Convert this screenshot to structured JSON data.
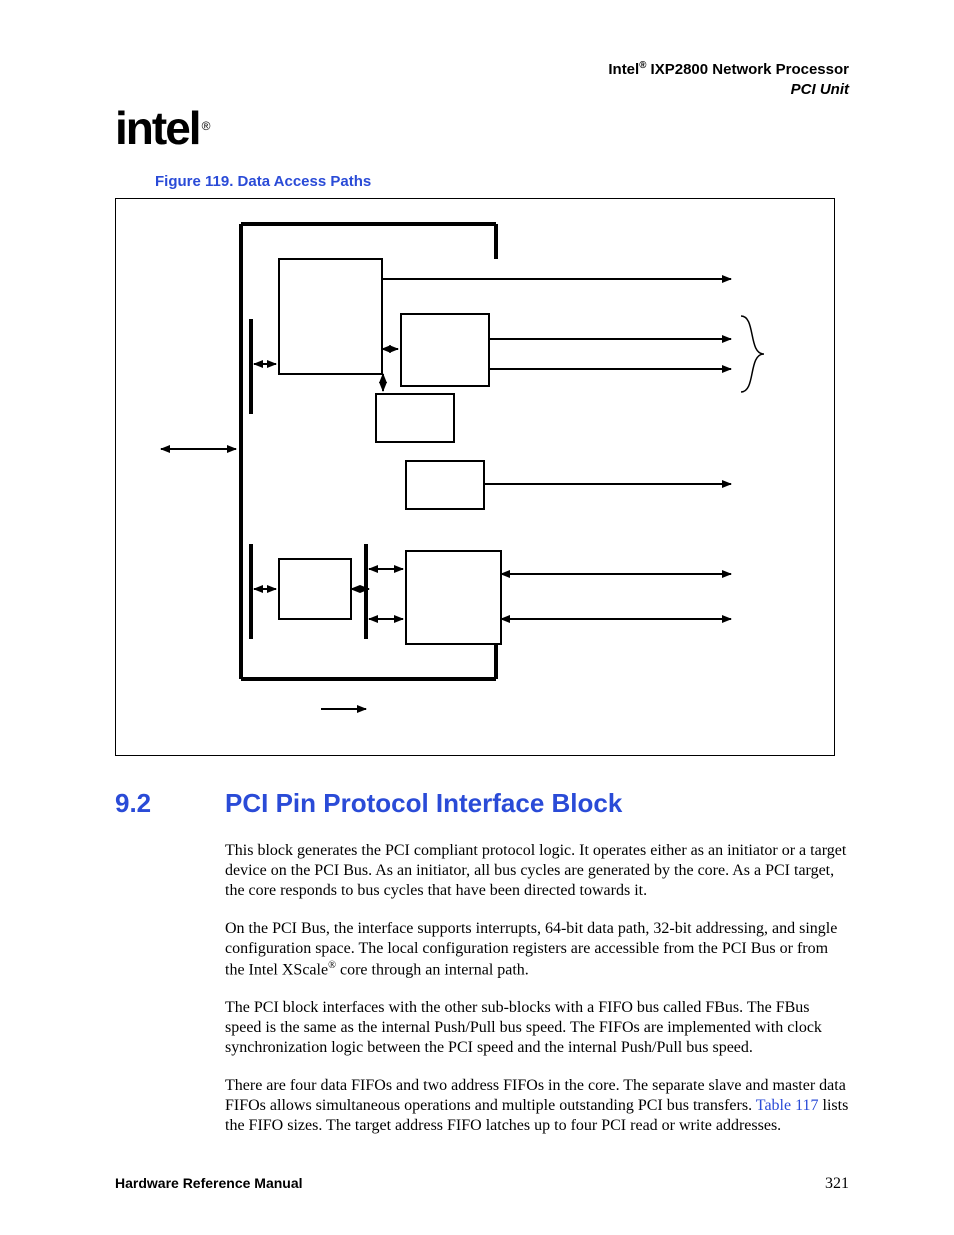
{
  "header": {
    "product_prefix": "Intel",
    "product": " IXP2800 Network Processor",
    "unit": "PCI Unit"
  },
  "logo": {
    "text": "intel",
    "reg": "®"
  },
  "figure": {
    "caption": "Figure 119. Data Access Paths"
  },
  "section": {
    "number": "9.2",
    "title": "PCI Pin Protocol Interface Block"
  },
  "paragraphs": {
    "p1": "This block generates the PCI compliant protocol logic. It operates either as an initiator or a target device on the PCI Bus. As an initiator, all bus cycles are generated by the core. As a PCI target, the core responds to bus cycles that have been directed towards it.",
    "p2a": "On the PCI Bus, the interface supports interrupts, 64-bit data path, 32-bit addressing, and single configuration space. The local configuration registers are accessible from the PCI Bus or from the Intel XScale",
    "p2b": " core through an internal path.",
    "p3": "The PCI block interfaces with the other sub-blocks with a FIFO bus called FBus. The FBus speed is the same as the internal Push/Pull bus speed. The FIFOs are implemented with clock synchronization logic between the PCI speed and the internal Push/Pull bus speed.",
    "p4a": "There are four data FIFOs and two address FIFOs in the core. The separate slave and master data FIFOs allows simultaneous operations and multiple outstanding PCI bus transfers. ",
    "p4_xref": "Table 117",
    "p4b": " lists the FIFO sizes. The target address FIFO latches up to four PCI read or write addresses."
  },
  "footer": {
    "manual": "Hardware Reference Manual",
    "page": "321"
  }
}
